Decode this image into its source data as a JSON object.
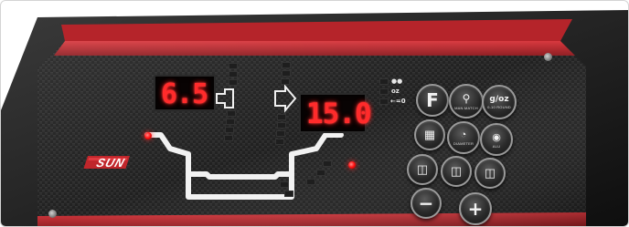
{
  "display_left": {
    "value": "6.5"
  },
  "display_right": {
    "value": "15.0"
  },
  "units": {
    "oz": "oz",
    "zero": "←=0"
  },
  "logo": {
    "text": "SUN"
  },
  "buttons": {
    "f": {
      "label": "F"
    },
    "manual": {
      "sub": "MAN.MATCH"
    },
    "gramsoz": {
      "label": "g/oz",
      "sub": "0-10 ROUND"
    },
    "diameter": {
      "sub": "DIAMETER"
    },
    "alu": {
      "sub": "ALU"
    },
    "rim1": {
      "sub": ""
    },
    "rim2": {
      "sub": ""
    },
    "rim3": {
      "sub": ""
    },
    "minus": {
      "label": "−"
    },
    "plus": {
      "label": "+"
    }
  },
  "colors": {
    "accent_red": "#c0262b",
    "panel_dark": "#1b1b1b",
    "led_red": "#ff2020"
  }
}
